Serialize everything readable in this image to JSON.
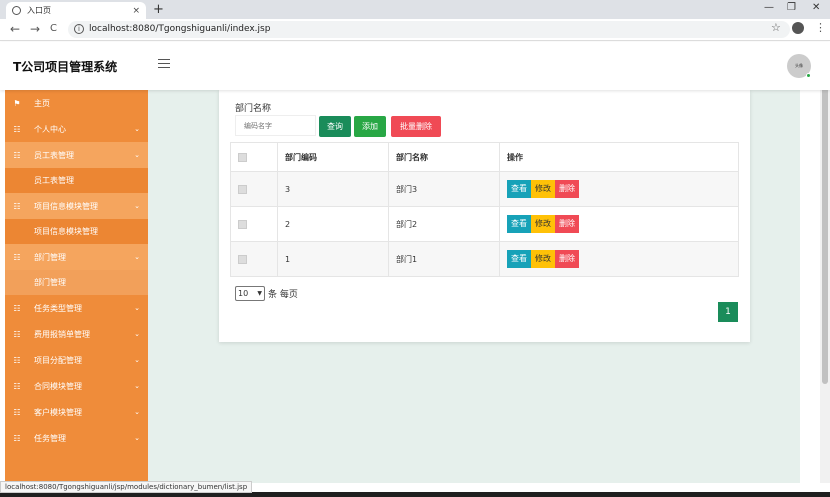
{
  "browser": {
    "tab_title": "入口页",
    "tab_close": "×",
    "new_tab": "+",
    "url": "localhost:8080/Tgongshiguanli/index.jsp",
    "status_url": "localhost:8080/Tgongshiguanli/jsp/modules/dictionary_bumen/list.jsp",
    "minimize": "—",
    "restore": "❐",
    "close": "✕",
    "back": "←",
    "forward": "→",
    "reload": "C",
    "info": "i",
    "star": "☆",
    "kebab": "⋮"
  },
  "header": {
    "title": "T公司项目管理系统",
    "avatar_text": "头像"
  },
  "sidebar": {
    "items": [
      {
        "label": "主页",
        "icon": "flag-icon",
        "glyph": "⚑",
        "chevron": ""
      },
      {
        "label": "个人中心",
        "icon": "grid-icon",
        "glyph": "☷",
        "chevron": "⌄"
      },
      {
        "label": "员工表管理",
        "icon": "grid-icon",
        "glyph": "☷",
        "chevron": "⌄"
      },
      {
        "label": "员工表管理",
        "sub": true
      },
      {
        "label": "项目信息模块管理",
        "icon": "grid-icon",
        "glyph": "☷",
        "chevron": "⌄"
      },
      {
        "label": "项目信息模块管理",
        "sub": true
      },
      {
        "label": "部门管理",
        "icon": "grid-icon",
        "glyph": "☷",
        "chevron": "⌄"
      },
      {
        "label": "部门管理",
        "sub": true
      },
      {
        "label": "任务类型管理",
        "icon": "grid-icon",
        "glyph": "☷",
        "chevron": "⌄"
      },
      {
        "label": "费用报销单管理",
        "icon": "grid-icon",
        "glyph": "☷",
        "chevron": "⌄"
      },
      {
        "label": "项目分配管理",
        "icon": "grid-icon",
        "glyph": "☷",
        "chevron": "⌄"
      },
      {
        "label": "合同模块管理",
        "icon": "grid-icon",
        "glyph": "☷",
        "chevron": "⌄"
      },
      {
        "label": "客户模块管理",
        "icon": "grid-icon",
        "glyph": "☷",
        "chevron": "⌄"
      },
      {
        "label": "任务管理",
        "icon": "grid-icon",
        "glyph": "☷",
        "chevron": "⌄"
      }
    ]
  },
  "search": {
    "label": "部门名称",
    "placeholder": "编码名字",
    "query_label": "查询",
    "add_label": "添加",
    "batch_delete_label": "批量删除"
  },
  "table": {
    "headers": [
      "",
      "部门编码",
      "部门名称",
      "操作"
    ],
    "rows": [
      {
        "code": "3",
        "name": "部门3"
      },
      {
        "code": "2",
        "name": "部门2"
      },
      {
        "code": "1",
        "name": "部门1"
      }
    ],
    "actions": {
      "view": "查看",
      "edit": "修改",
      "delete": "删除"
    }
  },
  "pagination": {
    "page_size": "10",
    "page_size_suffix": "条 每页",
    "current_page": "1"
  },
  "colors": {
    "sidebar": "#ef8c3a",
    "primary": "#1a8c5a",
    "success": "#28a745",
    "danger": "#f04a55",
    "info": "#17a2b8",
    "warning": "#ffc107"
  }
}
